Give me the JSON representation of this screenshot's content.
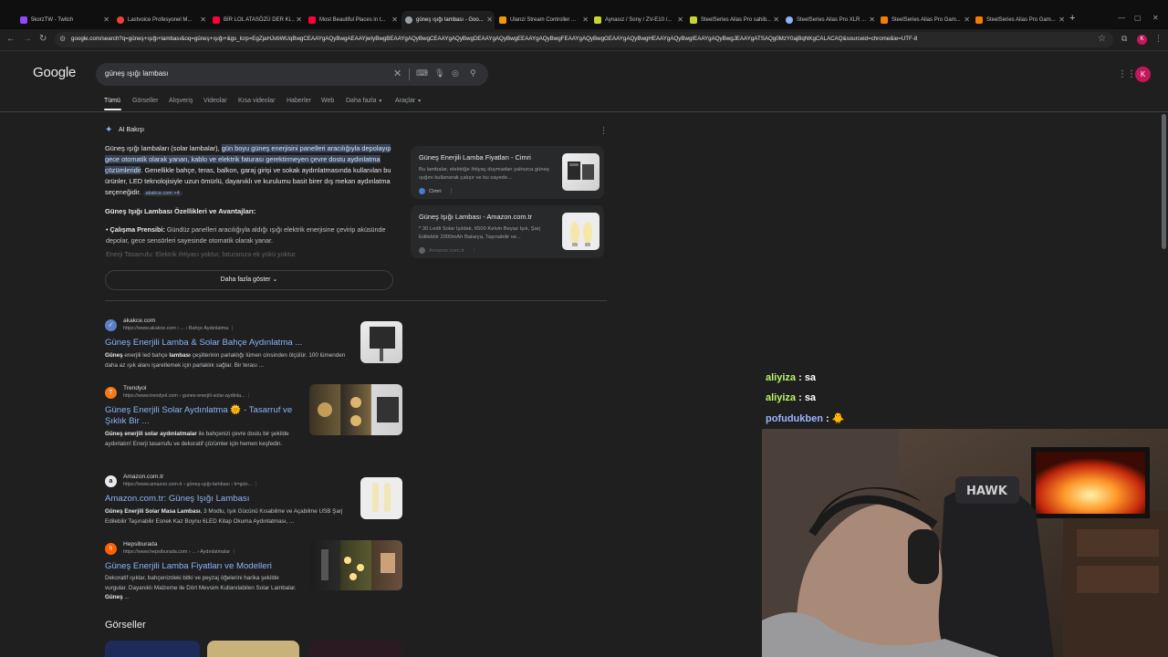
{
  "browser": {
    "tabs": [
      {
        "title": "5korzTW - Twitch",
        "color": "#9146ff"
      },
      {
        "title": "Lastvoice Profesyonel M...",
        "color": "#ea4335"
      },
      {
        "title": "BİR LOL ATASÖZÜ DER Ki...",
        "color": "#ff0033"
      },
      {
        "title": "Most Beautiful Places in t...",
        "color": "#ff0033"
      },
      {
        "title": "güneş ışığı lambası - Goo...",
        "color": "#9aa0a6"
      },
      {
        "title": "Ulanzi Stream Controller ...",
        "color": "#f29900"
      },
      {
        "title": "Aynasız / Sony / ZV-E10 /...",
        "color": "#c6d62d"
      },
      {
        "title": "SteelSeries Alias Pro sahib...",
        "color": "#c6d62d"
      },
      {
        "title": "SteelSeries Alias Pro XLR ...",
        "color": "#8ab4f8"
      },
      {
        "title": "SteelSeries Alias Pro Gam...",
        "color": "#f57c00"
      },
      {
        "title": "SteelSeries Alias Pro Gam...",
        "color": "#f57c00"
      }
    ],
    "url": "google.com/search?q=güneş+ışığı+lambası&oq=güneş+ışığı+&gs_lcrp=EgZjaHJvbWUqBwgCEAAYgAQyBwgAEAAYjwIyBwgBEAAYgAQyBwgCEAAYgAQyBwgDEAAYgAQyBwgEEAAYgAQyBwgFEAAYgAQyBwgGEAAYgAQyBwgHEAAYgAQyBwgIEAAYgAQyBwgJEAAYgATSAQg0MzY0ajBqNKgCALACAQ&sourceid=chrome&ie=UTF-8",
    "profile_initial": "K"
  },
  "google": {
    "logo": "Google",
    "query": "güneş ışığı lambası",
    "avatar_initial": "K",
    "tabs": [
      "Tümü",
      "Görseller",
      "Alışveriş",
      "Videolar",
      "Kısa videolar",
      "Haberler",
      "Web",
      "Daha fazla",
      "Araçlar"
    ]
  },
  "ai_overview": {
    "title": "AI Bakışı",
    "p1_plain_a": "Güneş ışığı lambaları (solar lambalar), ",
    "p1_highlight": "gün boyu güneş enerjisini panelleri aracılığıyla depolayıp gece otomatik olarak yanan, kablo ve elektrik faturası gerektirmeyen çevre dostu aydınlatma çözümleridir",
    "p1_plain_b": ". Genellikle bahçe, teras, balkon, garaj girişi ve sokak aydınlatmasında kullanılan bu ürünler, LED teknolojisiyle uzun ömürlü, dayanıklı ve kurulumu basit birer dış mekan aydınlatma seçeneğidir.",
    "p1_source": "akakce.com +4",
    "features_title": "Güneş Işığı Lambası Özellikleri ve Avantajları:",
    "feature1_label": "Çalışma Prensibi:",
    "feature1_text": " Gündüz panelleri aracılığıyla aldığı ışığı elektrik enerjisine çevirip aküsünde depolar, gece sensörleri sayesinde otomatik olarak yanar.",
    "feature2_faded": "Enerji Tasarrufu: Elektrik ihtiyacı yoktur, faturanıza ek yükü yoktur.",
    "more_label": "Daha fazla göster",
    "sources": [
      {
        "title": "Güneş Enerjili Lamba Fiyatları - Cimri",
        "desc": "Bu lambalar, elektriğe ihtiyaç duymadan yalnızca güneş ışığını kullanarak çalışır ve bu sayede...",
        "site": "Cimri"
      },
      {
        "title": "Güneş Işığı Lambası - Amazon.com.tr",
        "desc": "* 30 Ledli Solar Işıldak, 6500 Kelvin Beyaz Işık, Şarj Edilebilir 2000mAh Batarya, Taşınabilir ve...",
        "site": "Amazon.com.tr"
      }
    ]
  },
  "results": [
    {
      "site": "akakce.com",
      "url": "https://www.akakce.com › ... › Bahçe Aydınlatma",
      "title": "Güneş Enerjili Lamba & Solar Bahçe Aydınlatma ...",
      "snippet_bold": "Güneş",
      "snippet_mid1": " enerjili led bahçe ",
      "snippet_bold2": "lambası",
      "snippet_rest": " çeşitlerinin parlaklığı lümen cinsinden ölçülür. 100 lümenden daha az ışık alanı işaretlemek için parlaklık sağlar. Bir terası ...",
      "favicon": "✓"
    },
    {
      "site": "Trendyol",
      "url": "https://www.trendyol.com › gunes-enerjili-solar-aydinla...",
      "title": "Güneş Enerjili Solar Aydınlatma 🌞 - Tasarruf ve Şıklık Bir ...",
      "snippet_bold": "Güneş enerjili solar aydınlatmalar",
      "snippet_rest": " ile bahçenizi çevre dostu bir şekilde aydınlatın! Enerji tasarrufu ve dekoratif çözümler için hemen keşfedin.",
      "favicon": "T"
    },
    {
      "site": "Amazon.com.tr",
      "url": "https://www.amazon.com.tr › güneş-ışığı-lambası › k=gün...",
      "title": "Amazon.com.tr: Güneş Işığı Lambası",
      "snippet_bold": "Güneş Enerjili Solar Masa Lambası",
      "snippet_rest": ", 3 Modlu, Işık Gücünü Kısabilme ve Açabilme USB Şarj Edilebilir Taşınabilir Esnek Kaz Boynu 6LED Kitap Okuma Aydınlatması, ...",
      "favicon": "a"
    },
    {
      "site": "Hepsiburada",
      "url": "https://www.hepsiburada.com › ... › Aydınlatmalar",
      "title": "Güneş Enerjili Lamba Fiyatları ve Modelleri",
      "snippet_plain": "Dekoratif ışıklar, bahçenizdeki bitki ve peyzaj öğelerini harika şekilde vurgular. Dayanıklı Malzeme ile Dört Mevsim Kullanılabilen Solar Lambalar. ",
      "snippet_bold": "Güneş",
      "snippet_rest": " ...",
      "favicon": "h"
    }
  ],
  "images_section": "Görseller",
  "chat": [
    {
      "user": "aliyiza",
      "sep": " : ",
      "msg": "sa",
      "color": "#b8f36a"
    },
    {
      "user": "aliyiza",
      "sep": " : ",
      "msg": "sa",
      "color": "#b8f36a"
    },
    {
      "user": "pofudukben",
      "sep": " : ",
      "msg": "",
      "color": "#9bb4ff"
    }
  ]
}
